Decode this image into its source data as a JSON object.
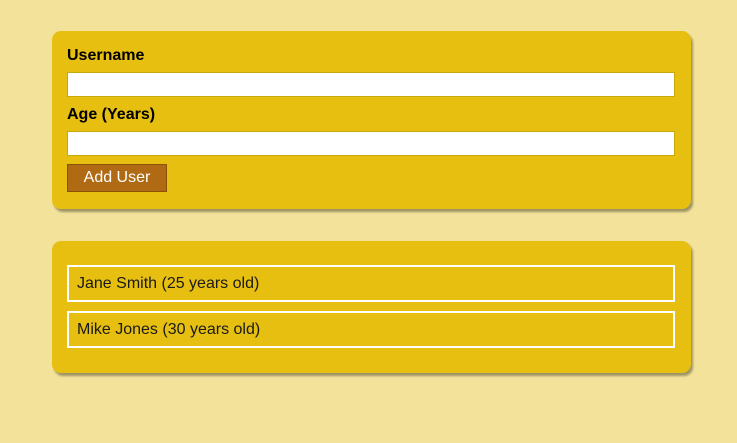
{
  "form": {
    "username_label": "Username",
    "username_value": "",
    "age_label": "Age (Years)",
    "age_value": "",
    "submit_label": "Add User"
  },
  "users": [
    {
      "display": "Jane Smith (25 years old)"
    },
    {
      "display": "Mike Jones (30 years old)"
    }
  ],
  "colors": {
    "page_background": "#f3e39a",
    "card_background": "#e6bf10",
    "button_background": "#b06a14",
    "item_border": "#ffffff"
  }
}
